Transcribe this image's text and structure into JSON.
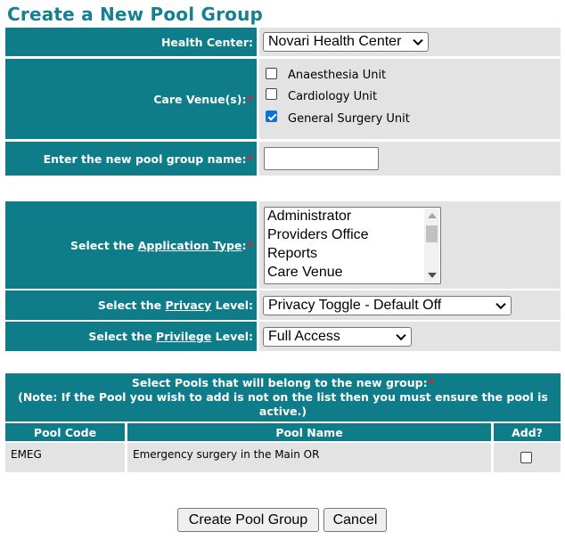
{
  "page": {
    "title": "Create a New Pool Group"
  },
  "health_center": {
    "label": "Health Center:",
    "selected": "Novari Health Center"
  },
  "care_venues": {
    "label": "Care Venue(s):",
    "required_mark": "*",
    "options": [
      {
        "label": "Anaesthesia Unit",
        "checked": false
      },
      {
        "label": "Cardiology Unit",
        "checked": false
      },
      {
        "label": "General Surgery Unit",
        "checked": true
      }
    ]
  },
  "pool_group_name": {
    "label": "Enter the new pool group name:",
    "required_mark": "*",
    "value": ""
  },
  "application_type": {
    "label_prefix": "Select the ",
    "label_link": "Application Type",
    "label_suffix": ":",
    "required_mark": "*",
    "options": [
      "Administrator",
      "Providers Office",
      "Reports",
      "Care Venue"
    ]
  },
  "privacy_level": {
    "label_prefix": "Select the ",
    "label_link": "Privacy",
    "label_suffix": " Level:",
    "selected": "Privacy Toggle - Default Off"
  },
  "privilege_level": {
    "label_prefix": "Select the ",
    "label_link": "Privilege",
    "label_suffix": " Level:",
    "selected": "Full Access"
  },
  "pools": {
    "header_line1": "Select Pools that will belong to the new group:",
    "required_mark": "*",
    "header_note": "(Note: If the Pool you wish to add is not on the list then you must ensure the pool is active.)",
    "columns": [
      "Pool Code",
      "Pool Name",
      "Add?"
    ],
    "rows": [
      {
        "code": "EMEG",
        "name": "Emergency surgery in the Main OR",
        "add": false
      }
    ]
  },
  "buttons": {
    "create": "Create Pool Group",
    "cancel": "Cancel"
  }
}
